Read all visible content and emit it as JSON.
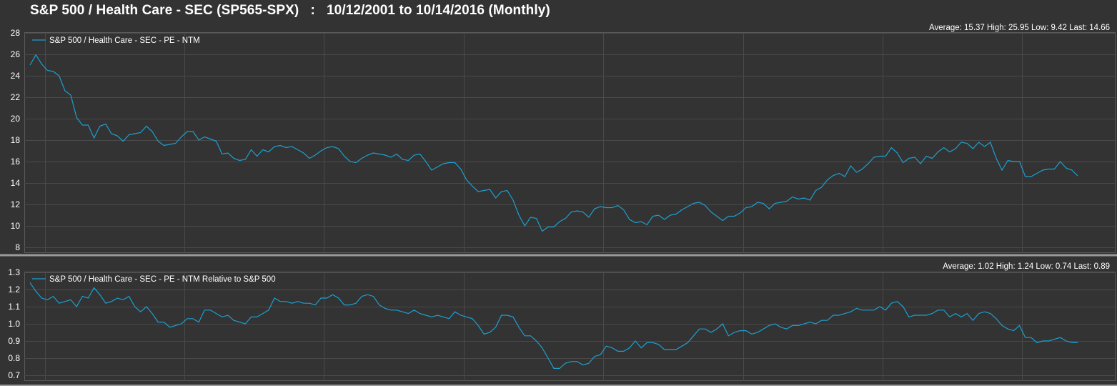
{
  "title": "S&P 500 / Health Care - SEC (SP565-SPX)   :   10/12/2001 to 10/14/2016 (Monthly)",
  "colors": {
    "background": "#333333",
    "grid": "#4a4a4a",
    "series": "#1e9fd0",
    "divider": "#9a9a9a"
  },
  "chart_data": [
    {
      "type": "line",
      "title": "",
      "series": [
        {
          "name": "S&P 500 / Health Care - SEC - PE - NTM",
          "values": [
            25.0,
            25.95,
            25.1,
            24.5,
            24.4,
            24.0,
            22.6,
            22.2,
            20.1,
            19.4,
            19.4,
            18.2,
            19.3,
            19.5,
            18.6,
            18.4,
            17.9,
            18.5,
            18.6,
            18.7,
            19.3,
            18.8,
            17.9,
            17.5,
            17.6,
            17.7,
            18.3,
            18.8,
            18.8,
            18.0,
            18.3,
            18.1,
            17.9,
            16.7,
            16.8,
            16.3,
            16.1,
            16.2,
            17.1,
            16.5,
            17.1,
            16.9,
            17.4,
            17.5,
            17.3,
            17.4,
            17.1,
            16.8,
            16.3,
            16.6,
            17.0,
            17.3,
            17.4,
            17.2,
            16.5,
            16.0,
            15.9,
            16.3,
            16.6,
            16.8,
            16.7,
            16.6,
            16.4,
            16.7,
            16.2,
            16.1,
            16.6,
            16.7,
            16.0,
            15.2,
            15.5,
            15.8,
            15.9,
            15.9,
            15.3,
            14.3,
            13.7,
            13.2,
            13.3,
            13.4,
            12.6,
            13.2,
            13.3,
            12.4,
            11.0,
            10.0,
            10.8,
            10.7,
            9.5,
            9.9,
            9.9,
            10.4,
            10.7,
            11.3,
            11.4,
            11.3,
            10.8,
            11.6,
            11.8,
            11.7,
            11.7,
            11.9,
            11.5,
            10.6,
            10.3,
            10.4,
            10.1,
            10.9,
            11.0,
            10.6,
            11.0,
            11.1,
            11.5,
            11.8,
            12.1,
            12.2,
            11.9,
            11.3,
            10.9,
            10.5,
            10.9,
            10.9,
            11.2,
            11.7,
            11.8,
            12.2,
            12.1,
            11.6,
            12.1,
            12.2,
            12.3,
            12.7,
            12.5,
            12.6,
            12.4,
            13.3,
            13.6,
            14.3,
            14.7,
            14.9,
            14.6,
            15.6,
            15.0,
            15.3,
            15.8,
            16.4,
            16.5,
            16.5,
            17.3,
            16.8,
            15.9,
            16.3,
            16.4,
            15.8,
            16.5,
            16.3,
            16.9,
            17.3,
            16.9,
            17.2,
            17.8,
            17.7,
            17.2,
            17.8,
            17.4,
            17.8,
            16.3,
            15.2,
            16.1,
            16.0,
            16.0,
            14.6,
            14.6,
            14.9,
            15.2,
            15.3,
            15.3,
            16.0,
            15.4,
            15.2,
            14.66
          ]
        }
      ],
      "stats": "Average: 15.37 High: 25.95 Low: 9.42 Last: 14.66",
      "ylim": [
        8,
        28
      ],
      "yticks": [
        "8",
        "10",
        "12",
        "14",
        "16",
        "18",
        "20",
        "22",
        "24",
        "26",
        "28"
      ],
      "grid": true,
      "legend": "top-left"
    },
    {
      "type": "line",
      "title": "",
      "series": [
        {
          "name": "S&P 500 / Health Care - SEC - PE - NTM Relative to S&P 500",
          "values": [
            1.24,
            1.19,
            1.15,
            1.14,
            1.16,
            1.12,
            1.13,
            1.14,
            1.1,
            1.16,
            1.15,
            1.21,
            1.17,
            1.12,
            1.13,
            1.15,
            1.14,
            1.16,
            1.1,
            1.07,
            1.1,
            1.06,
            1.01,
            1.01,
            0.98,
            0.99,
            1.0,
            1.03,
            1.03,
            1.01,
            1.08,
            1.08,
            1.06,
            1.04,
            1.05,
            1.02,
            1.01,
            1.0,
            1.04,
            1.04,
            1.06,
            1.08,
            1.15,
            1.13,
            1.13,
            1.12,
            1.13,
            1.12,
            1.12,
            1.11,
            1.15,
            1.15,
            1.17,
            1.15,
            1.11,
            1.11,
            1.12,
            1.16,
            1.17,
            1.16,
            1.11,
            1.09,
            1.08,
            1.08,
            1.07,
            1.06,
            1.08,
            1.06,
            1.05,
            1.04,
            1.05,
            1.04,
            1.03,
            1.07,
            1.05,
            1.04,
            1.03,
            0.99,
            0.94,
            0.95,
            0.98,
            1.05,
            1.05,
            1.04,
            0.98,
            0.93,
            0.93,
            0.9,
            0.86,
            0.8,
            0.74,
            0.74,
            0.77,
            0.78,
            0.78,
            0.76,
            0.77,
            0.81,
            0.82,
            0.87,
            0.86,
            0.84,
            0.84,
            0.86,
            0.9,
            0.86,
            0.89,
            0.89,
            0.88,
            0.85,
            0.85,
            0.85,
            0.87,
            0.89,
            0.93,
            0.97,
            0.97,
            0.95,
            0.97,
            1.0,
            0.93,
            0.95,
            0.96,
            0.96,
            0.94,
            0.95,
            0.97,
            0.99,
            1.0,
            0.98,
            0.97,
            0.99,
            0.99,
            1.0,
            1.01,
            1.0,
            1.02,
            1.02,
            1.05,
            1.05,
            1.06,
            1.07,
            1.09,
            1.08,
            1.08,
            1.08,
            1.1,
            1.08,
            1.12,
            1.13,
            1.1,
            1.04,
            1.05,
            1.05,
            1.05,
            1.06,
            1.08,
            1.08,
            1.04,
            1.06,
            1.04,
            1.06,
            1.02,
            1.06,
            1.07,
            1.06,
            1.03,
            0.99,
            0.97,
            0.96,
            0.99,
            0.92,
            0.92,
            0.89,
            0.9,
            0.9,
            0.91,
            0.92,
            0.9,
            0.89,
            0.89
          ]
        }
      ],
      "stats": "Average: 1.02 High: 1.24 Low: 0.74 Last: 0.89",
      "ylim": [
        0.7,
        1.3
      ],
      "yticks": [
        "0.7",
        "0.8",
        "0.9",
        "1.0",
        "1.1",
        "1.2",
        "1.3"
      ],
      "grid": true,
      "legend": "top-left"
    }
  ]
}
